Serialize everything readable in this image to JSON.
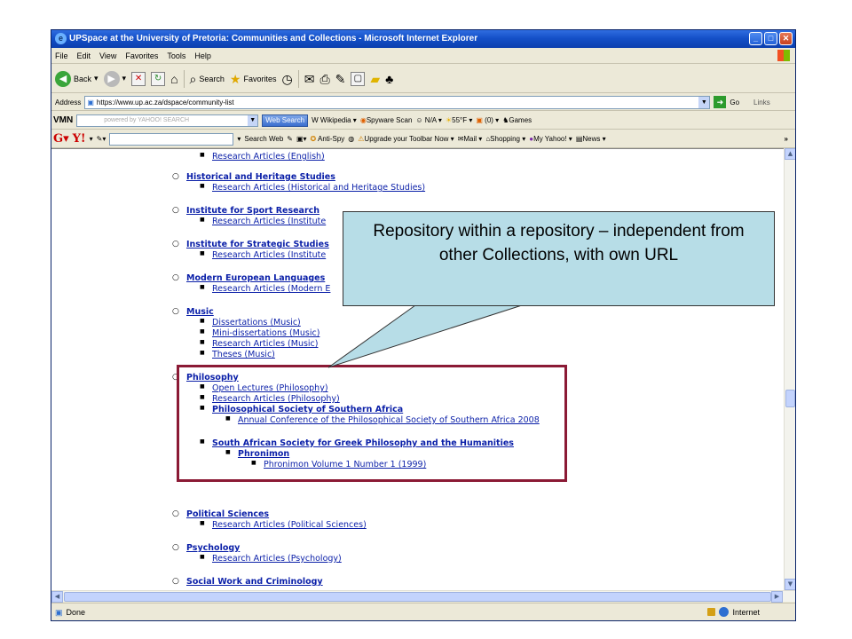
{
  "window": {
    "title": "UPSpace at the University of Pretoria: Communities and Collections - Microsoft Internet Explorer",
    "buttons": [
      "_",
      "□",
      "✕"
    ]
  },
  "menu": [
    "File",
    "Edit",
    "View",
    "Favorites",
    "Tools",
    "Help"
  ],
  "toolbar": {
    "back": "Back",
    "search": "Search",
    "favorites": "Favorites"
  },
  "address": {
    "label": "Address",
    "url": "https://www.up.ac.za/dspace/community-list",
    "go": "Go",
    "links": "Links"
  },
  "yahoo_toolbar_1": {
    "brand": "VMN",
    "search_placeholder": "powered by YAHOO! SEARCH",
    "web_search": "Web Search",
    "items": [
      "Wikipedia",
      "Spyware Scan",
      "N/A",
      "55°F",
      "(0)",
      "Games"
    ]
  },
  "yahoo_toolbar_2": {
    "search_web": "Search Web",
    "items": [
      "Anti-Spy",
      "Upgrade your Toolbar Now",
      "Mail",
      "Shopping",
      "My Yahoo!",
      "News"
    ]
  },
  "content": {
    "rows": [
      {
        "level": 2,
        "text": "Research Articles (English)"
      },
      {
        "level": 1,
        "text": "Historical and Heritage Studies"
      },
      {
        "level": 2,
        "text": "Research Articles (Historical and Heritage Studies)"
      },
      {
        "level": 1,
        "text": "Institute for Sport Research"
      },
      {
        "level": 2,
        "text": "Research Articles (Institute"
      },
      {
        "level": 1,
        "text": "Institute for Strategic Studies"
      },
      {
        "level": 2,
        "text": "Research Articles (Institute"
      },
      {
        "level": 1,
        "text": "Modern European Languages"
      },
      {
        "level": 2,
        "text": "Research Articles (Modern E"
      },
      {
        "level": 1,
        "text": "Music"
      },
      {
        "level": 2,
        "text": "Dissertations (Music)"
      },
      {
        "level": 2,
        "text": "Mini-dissertations (Music)"
      },
      {
        "level": 2,
        "text": "Research Articles (Music)"
      },
      {
        "level": 2,
        "text": "Theses (Music)"
      },
      {
        "level": 1,
        "text": "Philosophy"
      },
      {
        "level": 2,
        "text": "Open Lectures (Philosophy)"
      },
      {
        "level": 2,
        "text": "Research Articles (Philosophy)"
      },
      {
        "level": 2,
        "text": "Philosophical Society of Southern Africa",
        "bold": true
      },
      {
        "level": 3,
        "text": "Annual Conference of the Philosophical Society of Southern Africa 2008"
      },
      {
        "level": 2,
        "text": "South African Society for Greek Philosophy and the Humanities",
        "bold": true
      },
      {
        "level": 3,
        "text": "Phronimon",
        "bold": true
      },
      {
        "level": 4,
        "text": "Phronimon Volume 1 Number 1 (1999)"
      },
      {
        "level": 1,
        "text": "Political Sciences"
      },
      {
        "level": 2,
        "text": "Research Articles (Political Sciences)"
      },
      {
        "level": 1,
        "text": "Psychology"
      },
      {
        "level": 2,
        "text": "Research Articles (Psychology)"
      },
      {
        "level": 1,
        "text": "Social Work and Criminology"
      }
    ]
  },
  "status": {
    "text": "Done",
    "zone": "Internet"
  },
  "callout": {
    "text": "Repository within a repository – independent from other Collections, with own URL",
    "bg_color": "#b7dde7"
  },
  "highlight": {
    "border_color": "#8b1a35"
  }
}
